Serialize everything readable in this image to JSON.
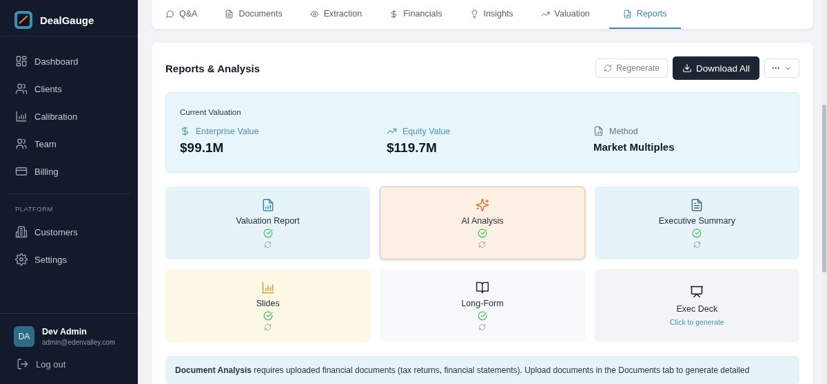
{
  "sidebar": {
    "brand": "DealGauge",
    "items": [
      {
        "label": "Dashboard",
        "selected": false
      },
      {
        "label": "Clients",
        "selected": false
      },
      {
        "label": "Calibration",
        "selected": false
      },
      {
        "label": "Team",
        "selected": false
      },
      {
        "label": "Billing",
        "selected": false
      }
    ],
    "section_title": "PLATFORM",
    "platform_items": [
      {
        "label": "Customers",
        "selected": false
      },
      {
        "label": "Settings",
        "selected": false
      }
    ],
    "user": {
      "initials": "DA",
      "name": "Dev Admin",
      "email": "admin@edenvalley.com"
    },
    "logout": "Log out"
  },
  "tabs": [
    {
      "label": "Q&A",
      "selected": false
    },
    {
      "label": "Documents",
      "selected": false
    },
    {
      "label": "Extraction",
      "selected": false
    },
    {
      "label": "Financials",
      "selected": false
    },
    {
      "label": "Insights",
      "selected": false
    },
    {
      "label": "Valuation",
      "selected": false
    },
    {
      "label": "Reports",
      "selected": true
    }
  ],
  "panel": {
    "title": "Reports & Analysis",
    "regenerate": "Regenerate",
    "download": "Download All",
    "more": "···",
    "valuation": {
      "title": "Current Valuation",
      "metrics": [
        {
          "label": "Enterprise Value",
          "value": "$99.1M"
        },
        {
          "label": "Equity Value",
          "value": "$119.7M"
        },
        {
          "label": "Method",
          "value": "Market Multiples"
        }
      ]
    },
    "reports": [
      {
        "name": "Valuation Report",
        "kind": "generated",
        "color": "#e6f4fa",
        "selected": false
      },
      {
        "name": "AI Analysis",
        "kind": "generated",
        "color": "#fcefe3",
        "selected": true
      },
      {
        "name": "Executive Summary",
        "kind": "generated",
        "color": "#e6f4fa",
        "selected": false
      },
      {
        "name": "Slides",
        "kind": "generated",
        "color": "#fdf8e6",
        "selected": false
      },
      {
        "name": "Long-Form",
        "kind": "generated",
        "color": "#f7f9fb",
        "selected": false
      },
      {
        "name": "Exec Deck",
        "kind": "pending",
        "color": "#f2f4f7",
        "selected": false,
        "hint": "Click to generate"
      }
    ],
    "notice": "**Document Analysis** requires uploaded financial documents (tax returns, financial statements). Upload documents in the Documents tab to generate detailed"
  }
}
